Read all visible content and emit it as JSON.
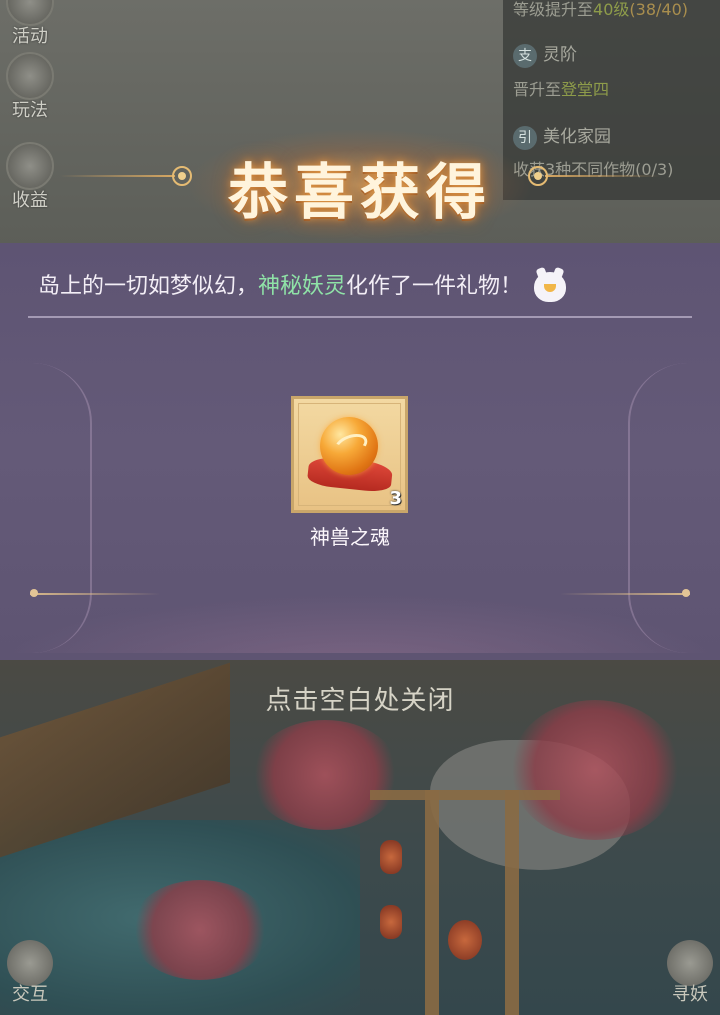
{
  "background": {
    "hud_left": [
      {
        "label": "活动",
        "icon": "event-icon"
      },
      {
        "label": "玩法",
        "icon": "gameplay-icon"
      },
      {
        "label": "收益",
        "icon": "income-bag-icon"
      }
    ],
    "tasks": {
      "top_line_prefix": "等级提升至",
      "top_line_level": "40级",
      "top_line_progress": "(38/40)",
      "task1_tag": "支",
      "task1_title": "灵阶",
      "task1_desc_prefix": "晋升至",
      "task1_desc_highlight": "登堂四",
      "task2_tag": "引",
      "task2_title": "美化家园",
      "task2_desc": "收获3种不同作物(0/3)"
    },
    "bottom_left_label": "交互",
    "bottom_right_label": "寻妖"
  },
  "dialog": {
    "title": "恭喜获得",
    "message_prefix": "岛上的一切如梦似幻，",
    "message_highlight": "神秘妖灵",
    "message_suffix": "化作了一件礼物！",
    "message_icon": "cat-spirit-icon",
    "item": {
      "icon": "divine-beast-orb-icon",
      "count": "3",
      "name": "神兽之魂"
    },
    "close_hint": "点击空白处关闭"
  },
  "colors": {
    "accent_green": "#8fe3a7",
    "title_glow": "#e09a4a",
    "panel": "#615776",
    "item_border": "#c9a66a"
  }
}
